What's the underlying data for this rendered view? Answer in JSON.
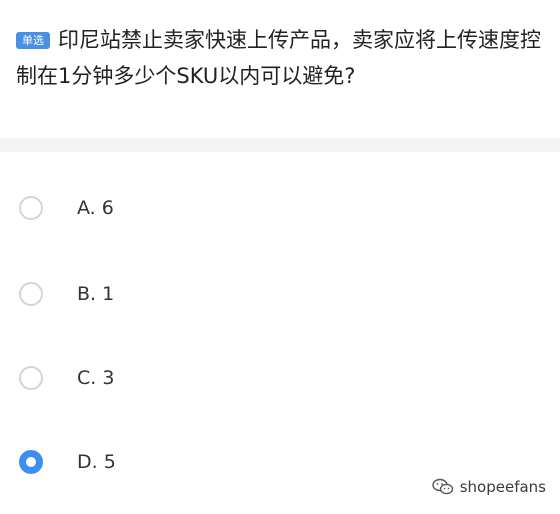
{
  "question": {
    "badge": "单选",
    "text": "印尼站禁止卖家快速上传产品，卖家应将上传速度控制在1分钟多少个SKU以内可以避免?"
  },
  "options": [
    {
      "label": "A. 6",
      "selected": false
    },
    {
      "label": "B. 1",
      "selected": false
    },
    {
      "label": "C. 3",
      "selected": false
    },
    {
      "label": "D. 5",
      "selected": true
    }
  ],
  "watermark": {
    "text": "shopeefans",
    "icon": "wechat-icon"
  },
  "colors": {
    "accent": "#3d8ef0",
    "badge": "#4a90e2",
    "divider": "#f4f4f6"
  }
}
